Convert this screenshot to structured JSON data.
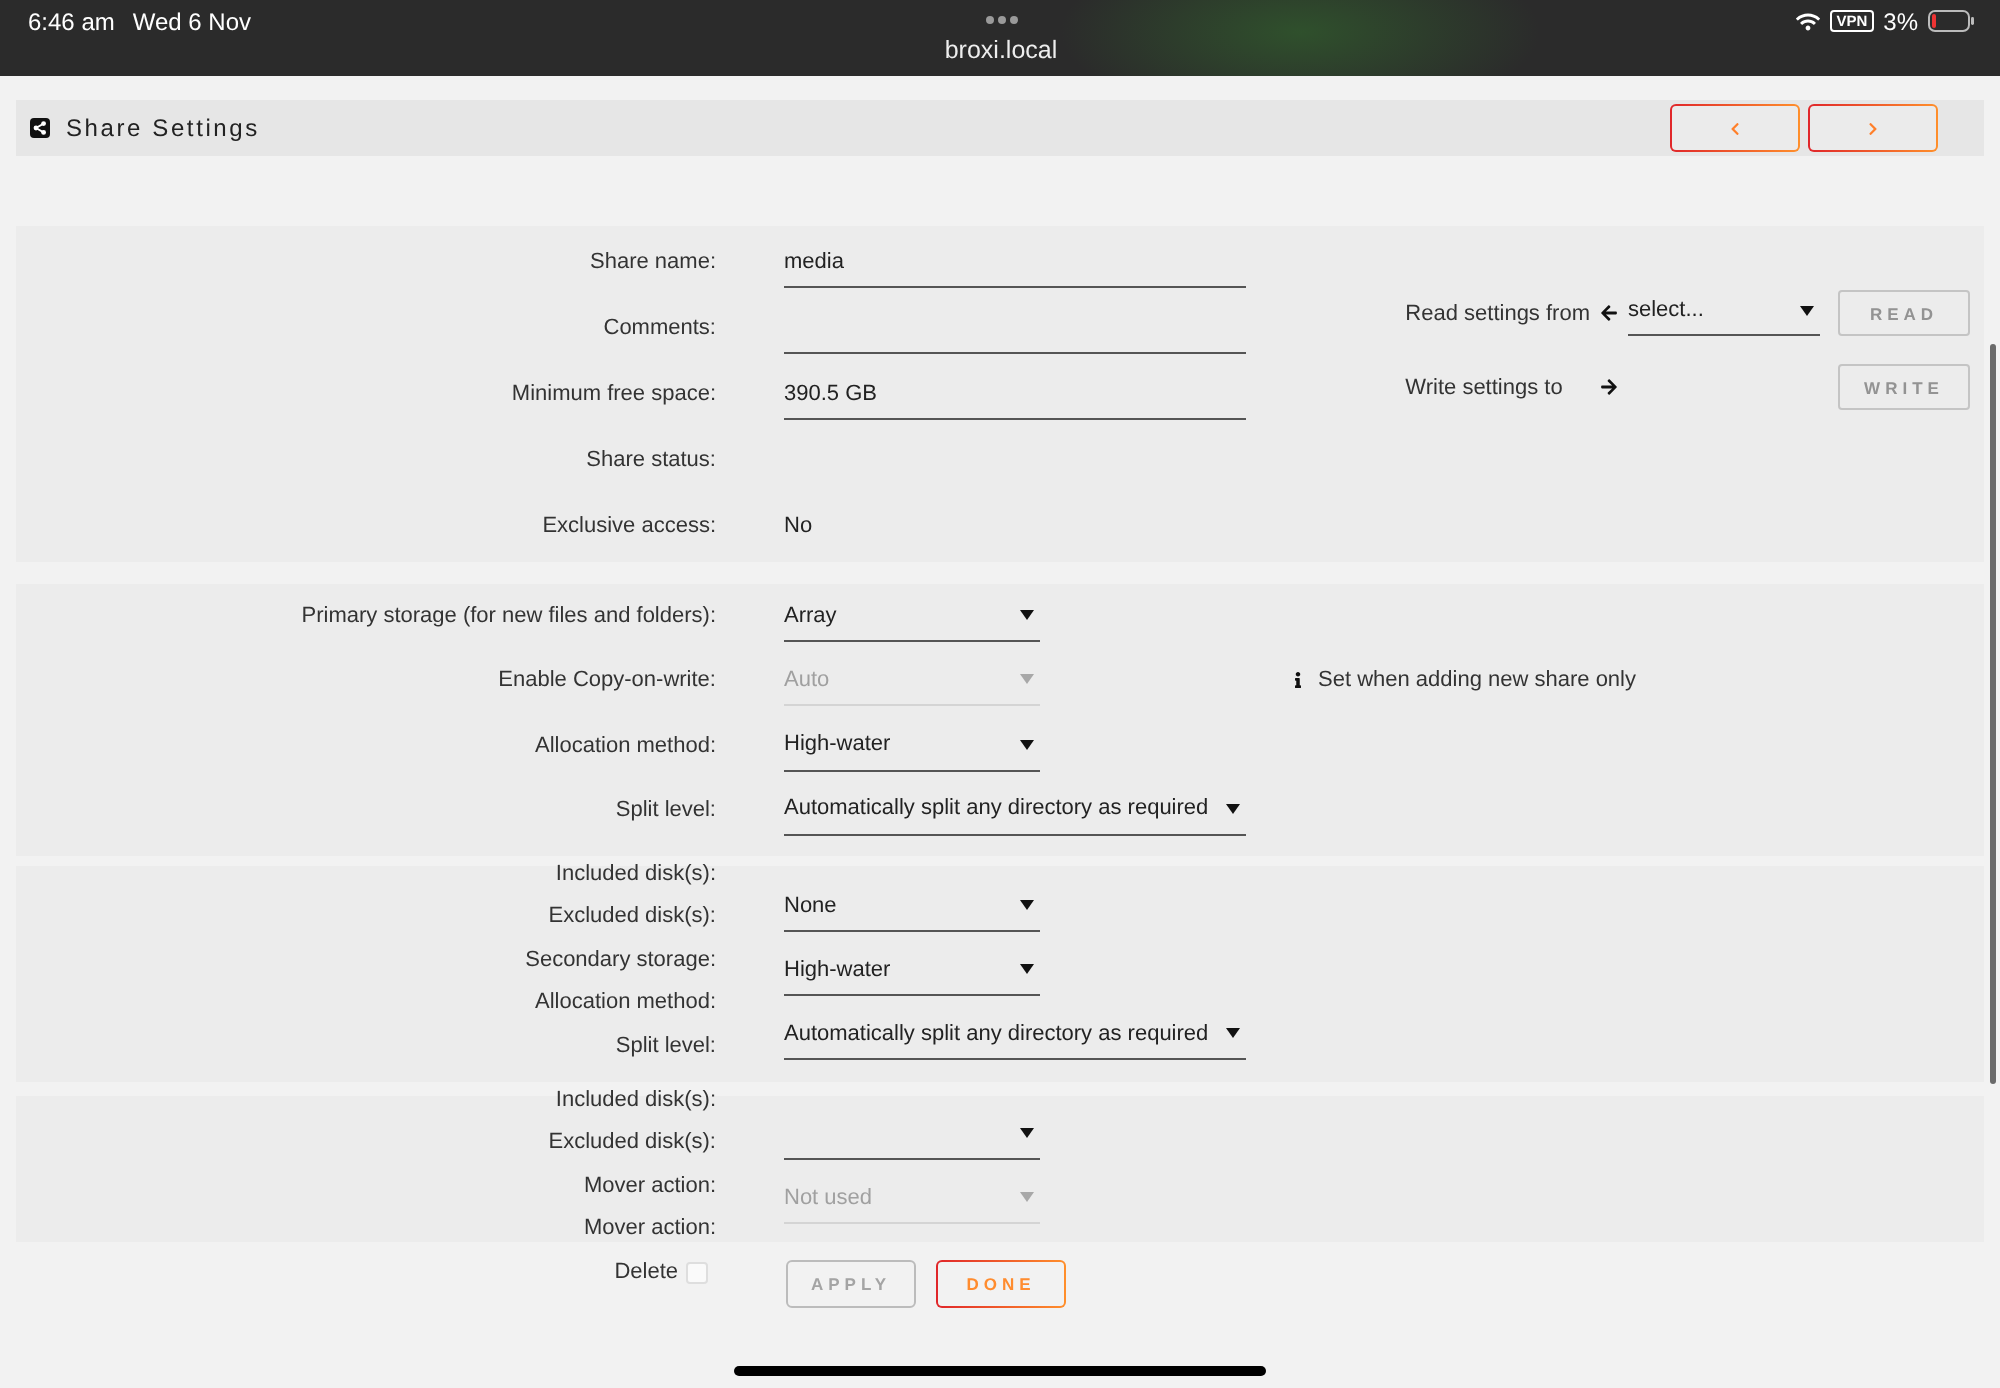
{
  "status_bar": {
    "time": "6:46 am",
    "date": "Wed 6 Nov",
    "address": "broxi.local",
    "vpn": "VPN",
    "battery": "3%"
  },
  "header": {
    "title": "Share Settings"
  },
  "share": {
    "fields": [
      {
        "kind": "input",
        "label": "Share name:",
        "value": "media"
      },
      {
        "kind": "input",
        "label": "Comments:"
      },
      {
        "kind": "input",
        "label": "Minimum free space:",
        "value": "390.5 GB"
      },
      {
        "kind": "text",
        "label": "Share status:"
      },
      {
        "kind": "text",
        "label": "Exclusive access:",
        "value": "No"
      }
    ],
    "read": {
      "label": "Read settings from",
      "value": "select...",
      "button": {
        "label": "READ",
        "disabled": true
      }
    },
    "write": {
      "label": "Write settings to",
      "button": {
        "label": "WRITE",
        "disabled": true
      }
    }
  },
  "primary": {
    "rows": [
      {
        "label": "Primary storage (for new files and folders):",
        "value": "Array",
        "wide": false,
        "disabled": false
      },
      {
        "label": "Enable Copy-on-write:",
        "value": "Auto",
        "wide": false,
        "disabled": true,
        "note": "Set when adding new share only"
      },
      {
        "label": "Allocation method:",
        "value": "High-water",
        "wide": false,
        "disabled": false
      },
      {
        "label": "Split level:",
        "value": "Automatically split any directory as required",
        "wide": true,
        "disabled": false
      }
    ]
  },
  "secondary": {
    "labels": [
      "Included disk(s):",
      "Excluded disk(s):",
      "Secondary storage:",
      "Allocation method:",
      "Split level:"
    ],
    "selects": [
      {
        "value": "None",
        "wide": false,
        "disabled": false
      },
      {
        "value": "High-water",
        "wide": false,
        "disabled": false
      },
      {
        "value": "Automatically split any directory as required",
        "wide": true,
        "disabled": false
      }
    ]
  },
  "mover": {
    "labels": [
      "Included disk(s):",
      "Excluded disk(s):",
      "Mover action:",
      "Mover action:"
    ],
    "selects": [
      {
        "wide": false,
        "disabled": false
      },
      {
        "value": "Not used",
        "wide": false,
        "disabled": true
      }
    ]
  },
  "footer": {
    "delete": {
      "label": "Delete",
      "checked": false
    },
    "buttons": [
      {
        "label": "APPLY",
        "disabled": true
      },
      {
        "label": "DONE",
        "disabled": false
      }
    ]
  }
}
